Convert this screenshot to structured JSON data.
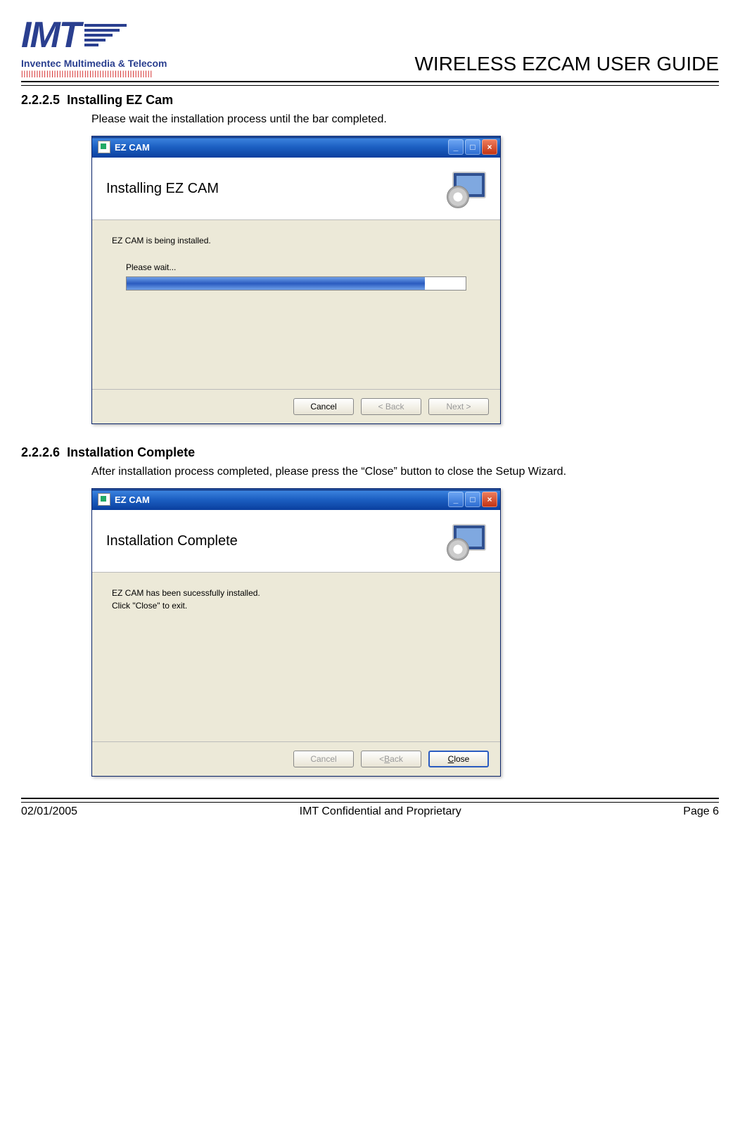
{
  "header": {
    "logo_main": "IMT",
    "logo_sub": "Inventec Multimedia & Telecom",
    "doc_title": "WIRELESS EZCAM USER GUIDE"
  },
  "sections": [
    {
      "number": "2.2.2.5",
      "title": "Installing EZ Cam",
      "body": "Please wait the installation process until the bar completed.",
      "dialog": {
        "window_title": "EZ CAM",
        "banner_title": "Installing EZ CAM",
        "body_line1": "EZ CAM is being installed.",
        "progress_label": "Please wait...",
        "progress_percent": 88,
        "buttons": {
          "cancel": {
            "label": "Cancel",
            "enabled": true,
            "default": false
          },
          "back": {
            "label": "< Back",
            "enabled": false,
            "default": false
          },
          "next": {
            "label": "Next >",
            "enabled": false,
            "default": false
          }
        }
      }
    },
    {
      "number": "2.2.2.6",
      "title": "Installation Complete",
      "body": "After installation process completed, please press the “Close” button to close the Setup Wizard.",
      "dialog": {
        "window_title": "EZ CAM",
        "banner_title": "Installation Complete",
        "body_line1": "EZ CAM has been sucessfully installed.",
        "body_line2": "Click \"Close\" to exit.",
        "buttons": {
          "cancel": {
            "label": "Cancel",
            "enabled": false,
            "default": false
          },
          "back": {
            "label": "< Back",
            "enabled": false,
            "default": false
          },
          "close": {
            "label": "Close",
            "enabled": true,
            "default": true
          }
        }
      }
    }
  ],
  "footer": {
    "date": "02/01/2005",
    "center": "IMT Confidential and Proprietary",
    "page": "Page 6"
  }
}
